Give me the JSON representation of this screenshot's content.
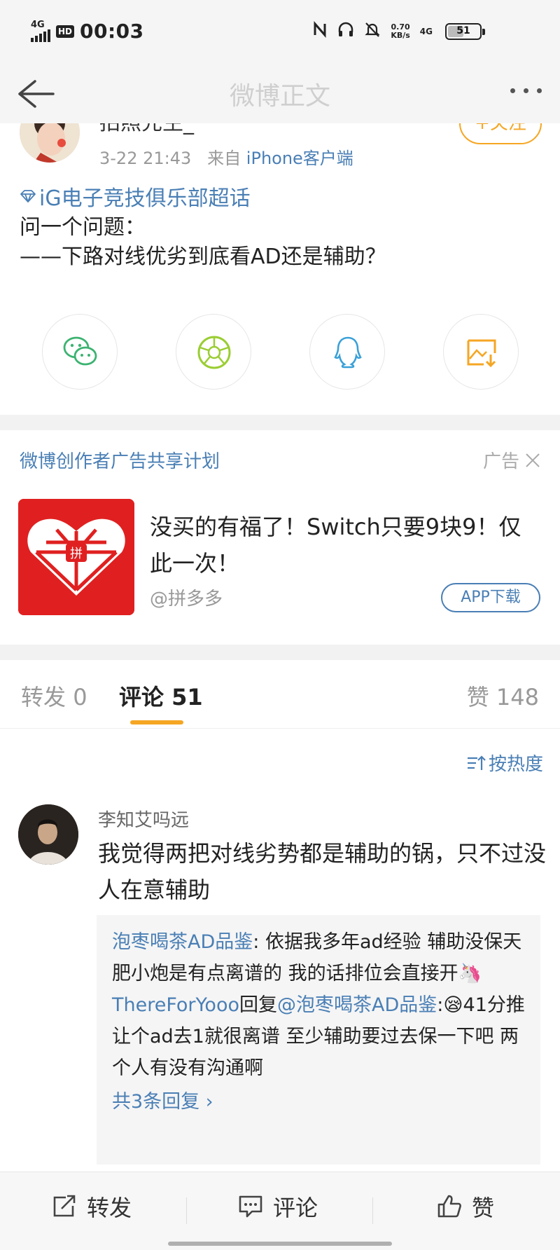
{
  "status_bar": {
    "network": "4G",
    "hd": "HD",
    "time": "00:03",
    "speed_value": "0.70",
    "speed_unit": "KB/s",
    "network2": "4G",
    "battery": "51",
    "battery_level": 0.51
  },
  "nav": {
    "title": "微博正文"
  },
  "post": {
    "author": "拍照先生_",
    "follow_label": "+关注",
    "time": "3-22 21:43",
    "source_prefix": "来自",
    "source": "iPhone客户端",
    "topic": "iG电子竞技俱乐部超话",
    "line1": "问一个问题：",
    "line2": "——下路对线优劣到底看AD还是辅助？"
  },
  "share": {
    "icons": [
      "wechat-icon",
      "moments-icon",
      "qq-icon",
      "save-image-icon"
    ]
  },
  "ad": {
    "program": "微博创作者广告共享计划",
    "label": "广告",
    "title": "没买的有福了！Switch只要9块9！仅此一次！",
    "source": "@拼多多",
    "download": "APP下载",
    "logo_text": "拼"
  },
  "tabs": {
    "repost_label": "转发",
    "repost_count": "0",
    "comment_label": "评论",
    "comment_count": "51",
    "like_label": "赞",
    "like_count": "148"
  },
  "sort": {
    "label": "按热度"
  },
  "comment": {
    "user": "李知艾吗远",
    "text": "我觉得两把对线劣势都是辅助的锅，只不过没人在意辅助",
    "replies": [
      {
        "name": "泡枣喝茶AD品鉴",
        "text": ": 依据我多年ad经验 辅助没保天肥小炮是有点离谱的 我的话排位会直接开🦄"
      },
      {
        "name": "ThereForYooo",
        "mid": "回复",
        "mention": "@泡枣喝茶AD品鉴",
        "text": ":😪41分推让个ad去1就很离谱 至少辅助要过去保一下吧 两个人有没有沟通啊"
      }
    ],
    "more_replies": "共3条回复 ›"
  },
  "bottom_bar": {
    "repost": "转发",
    "comment": "评论",
    "like": "赞"
  },
  "colors": {
    "link": "#4a7fb5",
    "accent": "#f5a623",
    "ad_red": "#e02020"
  }
}
